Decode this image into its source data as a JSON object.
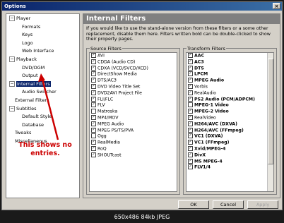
{
  "window": {
    "title": "Options",
    "close_label": "×"
  },
  "tree": [
    {
      "label": "Player",
      "exp": "−"
    },
    {
      "label": "Formats"
    },
    {
      "label": "Keys"
    },
    {
      "label": "Logo"
    },
    {
      "label": "Web Interface"
    },
    {
      "label": "Playback",
      "exp": "−"
    },
    {
      "label": "DVD/OGM"
    },
    {
      "label": "Output"
    },
    {
      "label": "Internal Filters",
      "exp": "−",
      "selected": true
    },
    {
      "label": "Audio Switcher"
    },
    {
      "label": "External Filters"
    },
    {
      "label": "Subtitles",
      "exp": "−"
    },
    {
      "label": "Default Style"
    },
    {
      "label": "Database"
    },
    {
      "label": "Tweaks"
    },
    {
      "label": "Miscellaneous"
    }
  ],
  "panel": {
    "header": "Internal Filters",
    "description": "If you would like to use the stand-alone version from these filters or a some other replacement, disable them here. Filters written bold can be double-clicked to show their property pages."
  },
  "source_filters": {
    "title": "Source Filters",
    "items": [
      {
        "label": "AVI",
        "checked": true,
        "bold": false
      },
      {
        "label": "CDDA (Audio CD)",
        "checked": true,
        "bold": false
      },
      {
        "label": "CDXA (VCD/SVCD/XCD)",
        "checked": true,
        "bold": false
      },
      {
        "label": "DirectShow Media",
        "checked": true,
        "bold": false
      },
      {
        "label": "DTS/AC3",
        "checked": true,
        "bold": false
      },
      {
        "label": "DVD Video Title Set",
        "checked": true,
        "bold": false
      },
      {
        "label": "DVD2AVI Project File",
        "checked": true,
        "bold": false
      },
      {
        "label": "FLI/FLC",
        "checked": true,
        "bold": false
      },
      {
        "label": "FLV",
        "checked": true,
        "bold": false
      },
      {
        "label": "Matroska",
        "checked": false,
        "bold": false
      },
      {
        "label": "MP4/MOV",
        "checked": true,
        "bold": false
      },
      {
        "label": "MPEG Audio",
        "checked": true,
        "bold": false
      },
      {
        "label": "MPEG PS/TS/PVA",
        "checked": true,
        "bold": false
      },
      {
        "label": "Ogg",
        "checked": false,
        "bold": false
      },
      {
        "label": "RealMedia",
        "checked": true,
        "bold": false
      },
      {
        "label": "RoQ",
        "checked": true,
        "bold": false
      },
      {
        "label": "SHOUTcast",
        "checked": true,
        "bold": false
      }
    ]
  },
  "transform_filters": {
    "title": "Transform Filters",
    "items": [
      {
        "label": "AAC",
        "checked": true,
        "bold": true
      },
      {
        "label": "AC3",
        "checked": true,
        "bold": true
      },
      {
        "label": "DTS",
        "checked": true,
        "bold": true
      },
      {
        "label": "LPCM",
        "checked": true,
        "bold": true
      },
      {
        "label": "MPEG Audio",
        "checked": true,
        "bold": true
      },
      {
        "label": "Vorbis",
        "checked": true,
        "bold": false
      },
      {
        "label": "RealAudio",
        "checked": true,
        "bold": false
      },
      {
        "label": "PS2 Audio (PCM/ADPCM)",
        "checked": true,
        "bold": true
      },
      {
        "label": "MPEG-1 Video",
        "checked": false,
        "bold": true
      },
      {
        "label": "MPEG-2 Video",
        "checked": true,
        "bold": true
      },
      {
        "label": "RealVideo",
        "checked": true,
        "bold": false
      },
      {
        "label": "H264/AVC (DXVA)",
        "checked": true,
        "bold": true
      },
      {
        "label": "H264/AVC (FFmpeg)",
        "checked": true,
        "bold": true
      },
      {
        "label": "VC1 (DXVA)",
        "checked": true,
        "bold": true
      },
      {
        "label": "VC1 (FFmpeg)",
        "checked": true,
        "bold": true
      },
      {
        "label": "Xvid/MPEG-4",
        "checked": true,
        "bold": true
      },
      {
        "label": "DivX",
        "checked": true,
        "bold": true
      },
      {
        "label": "MS MPEG-4",
        "checked": true,
        "bold": true
      },
      {
        "label": "FLV1/4",
        "checked": true,
        "bold": true
      }
    ]
  },
  "buttons": {
    "ok": "OK",
    "cancel": "Cancel",
    "apply": "Apply"
  },
  "annotation": "This shows no entries.",
  "footer": "650x486  84kb  JPEG"
}
